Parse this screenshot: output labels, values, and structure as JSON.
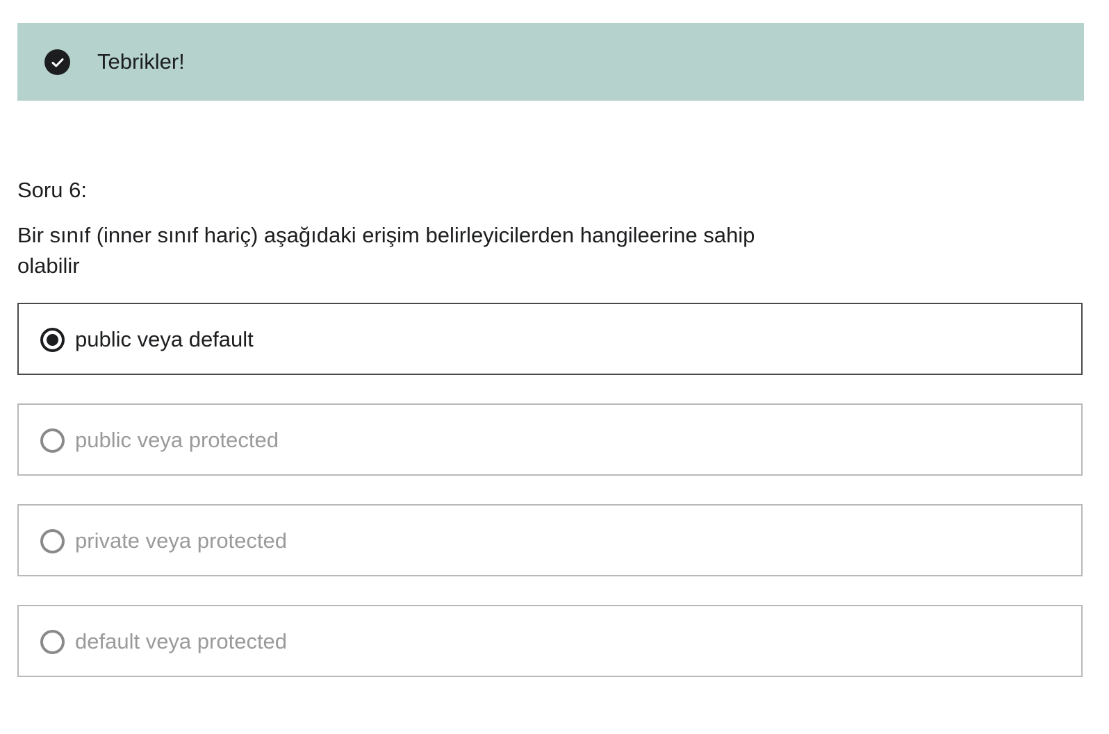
{
  "alert": {
    "icon": "check-circle-icon",
    "message": "Tebrikler!",
    "background_color": "#b5d2cd"
  },
  "question": {
    "label": "Soru 6:",
    "text": "Bir sınıf (inner sınıf hariç) aşağıdaki erişim belirleyicilerden hangileerine sahip olabilir"
  },
  "options": [
    {
      "label": "public veya default",
      "selected": true
    },
    {
      "label": "public veya protected",
      "selected": false
    },
    {
      "label": "private veya protected",
      "selected": false
    },
    {
      "label": "default veya protected",
      "selected": false
    }
  ]
}
